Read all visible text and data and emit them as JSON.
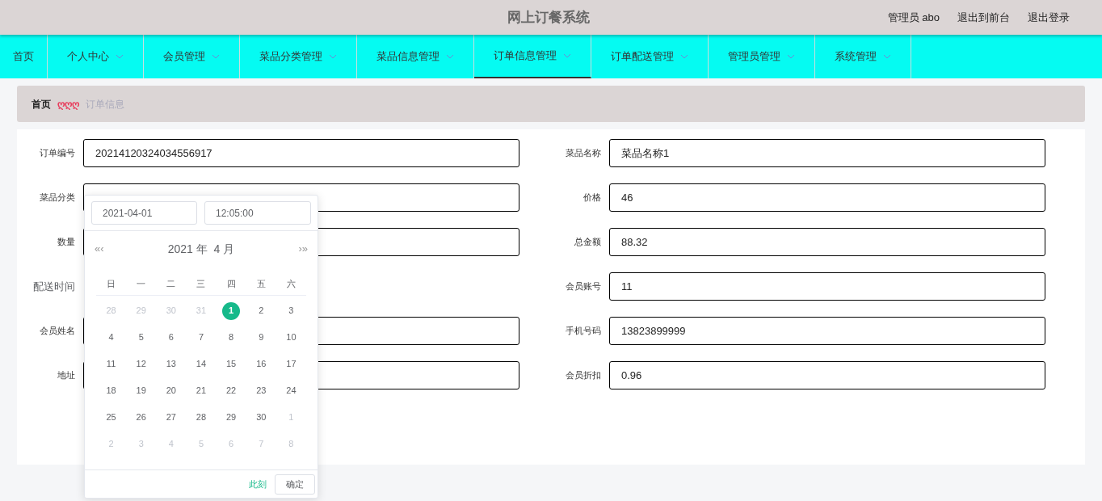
{
  "header": {
    "title": "网上订餐系统",
    "links": [
      "管理员 abo",
      "退出到前台",
      "退出登录"
    ]
  },
  "nav": [
    {
      "label": "首页",
      "dropdown": false,
      "selected": false
    },
    {
      "label": "个人中心",
      "dropdown": true,
      "selected": false
    },
    {
      "label": "会员管理",
      "dropdown": true,
      "selected": false
    },
    {
      "label": "菜品分类管理",
      "dropdown": true,
      "selected": false
    },
    {
      "label": "菜品信息管理",
      "dropdown": true,
      "selected": false
    },
    {
      "label": "订单信息管理",
      "dropdown": true,
      "selected": true
    },
    {
      "label": "订单配送管理",
      "dropdown": true,
      "selected": false
    },
    {
      "label": "管理员管理",
      "dropdown": true,
      "selected": false
    },
    {
      "label": "系统管理",
      "dropdown": true,
      "selected": false
    }
  ],
  "breadcrumb": {
    "home": "首页",
    "separator": "ღღღ",
    "current": "订单信息"
  },
  "form": {
    "left": [
      {
        "label": "订单编号",
        "value": "20214120324034556917"
      },
      {
        "label": "菜品分类"
      },
      {
        "label": "数量"
      },
      {
        "label": "配送时间",
        "kind": "date"
      },
      {
        "label": "会员姓名"
      },
      {
        "label": "地址"
      }
    ],
    "right": [
      {
        "label": "菜品名称",
        "value": "菜品名称1"
      },
      {
        "label": "价格",
        "value": "46"
      },
      {
        "label": "总金额",
        "value": "88.32"
      },
      {
        "label": "会员账号",
        "value": "11"
      },
      {
        "label": "手机号码",
        "value": "13823899999"
      },
      {
        "label": "会员折扣",
        "value": "0.96"
      }
    ]
  },
  "date_picker": {
    "date": "2021-04-01",
    "time": "12:05:00",
    "prev": "«‹",
    "title": "2021 年  4 月",
    "next": "›»",
    "weekdays": [
      "日",
      "一",
      "二",
      "三",
      "四",
      "五",
      "六"
    ],
    "days": [
      {
        "label": "28",
        "other": true,
        "selected": false
      },
      {
        "label": "29",
        "other": true,
        "selected": false
      },
      {
        "label": "30",
        "other": true,
        "selected": false
      },
      {
        "label": "31",
        "other": true,
        "selected": false
      },
      {
        "label": "1",
        "other": false,
        "selected": true
      },
      {
        "label": "2",
        "other": false,
        "selected": false
      },
      {
        "label": "3",
        "other": false,
        "selected": false
      },
      {
        "label": "4",
        "other": false,
        "selected": false
      },
      {
        "label": "5",
        "other": false,
        "selected": false
      },
      {
        "label": "6",
        "other": false,
        "selected": false
      },
      {
        "label": "7",
        "other": false,
        "selected": false
      },
      {
        "label": "8",
        "other": false,
        "selected": false
      },
      {
        "label": "9",
        "other": false,
        "selected": false
      },
      {
        "label": "10",
        "other": false,
        "selected": false
      },
      {
        "label": "11",
        "other": false,
        "selected": false
      },
      {
        "label": "12",
        "other": false,
        "selected": false
      },
      {
        "label": "13",
        "other": false,
        "selected": false
      },
      {
        "label": "14",
        "other": false,
        "selected": false
      },
      {
        "label": "15",
        "other": false,
        "selected": false
      },
      {
        "label": "16",
        "other": false,
        "selected": false
      },
      {
        "label": "17",
        "other": false,
        "selected": false
      },
      {
        "label": "18",
        "other": false,
        "selected": false
      },
      {
        "label": "19",
        "other": false,
        "selected": false
      },
      {
        "label": "20",
        "other": false,
        "selected": false
      },
      {
        "label": "21",
        "other": false,
        "selected": false
      },
      {
        "label": "22",
        "other": false,
        "selected": false
      },
      {
        "label": "23",
        "other": false,
        "selected": false
      },
      {
        "label": "24",
        "other": false,
        "selected": false
      },
      {
        "label": "25",
        "other": false,
        "selected": false
      },
      {
        "label": "26",
        "other": false,
        "selected": false
      },
      {
        "label": "27",
        "other": false,
        "selected": false
      },
      {
        "label": "28",
        "other": false,
        "selected": false
      },
      {
        "label": "29",
        "other": false,
        "selected": false
      },
      {
        "label": "30",
        "other": false,
        "selected": false
      },
      {
        "label": "1",
        "other": true,
        "selected": false
      },
      {
        "label": "2",
        "other": true,
        "selected": false
      },
      {
        "label": "3",
        "other": true,
        "selected": false
      },
      {
        "label": "4",
        "other": true,
        "selected": false
      },
      {
        "label": "5",
        "other": true,
        "selected": false
      },
      {
        "label": "6",
        "other": true,
        "selected": false
      },
      {
        "label": "7",
        "other": true,
        "selected": false
      },
      {
        "label": "8",
        "other": true,
        "selected": false
      }
    ],
    "now": "此刻",
    "confirm": "确定"
  }
}
